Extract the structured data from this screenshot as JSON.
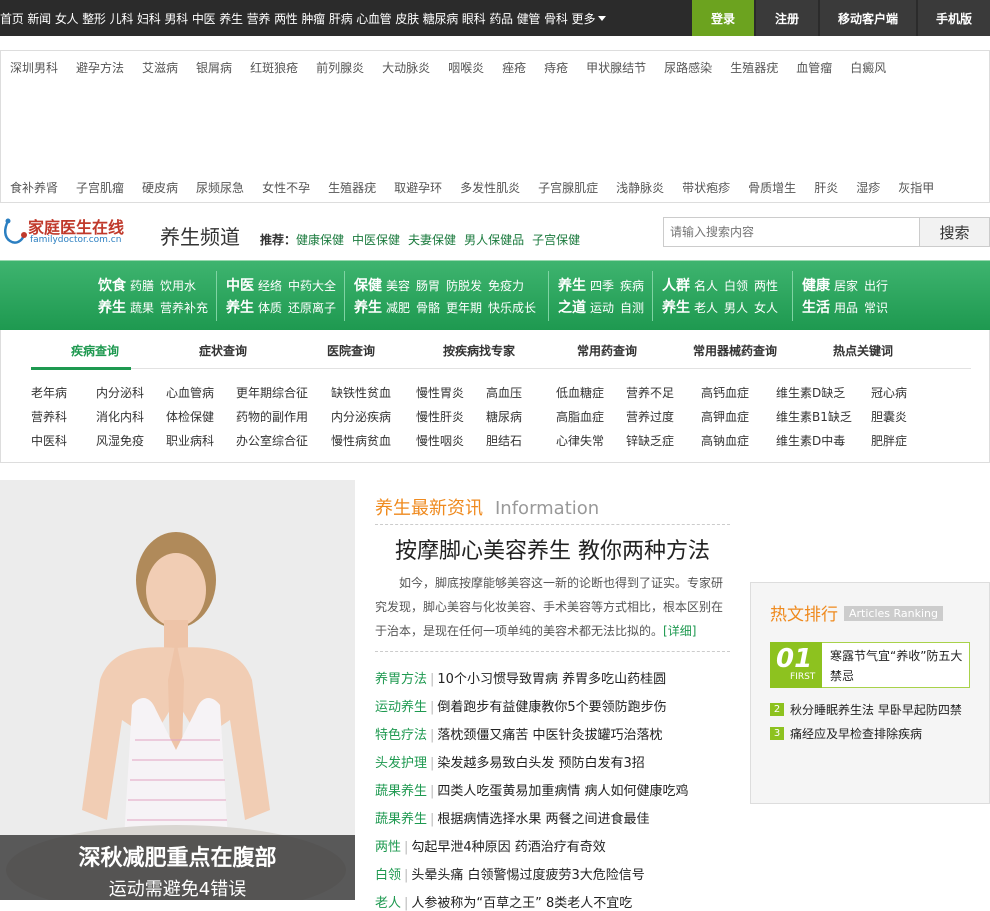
{
  "topnav": {
    "items": [
      "首页",
      "新闻",
      "女人",
      "整形",
      "儿科",
      "妇科",
      "男科",
      "中医",
      "养生",
      "营养",
      "两性",
      "肿瘤",
      "肝病",
      "心血管",
      "皮肤",
      "糖尿病",
      "眼科",
      "药品",
      "健管",
      "骨科"
    ],
    "more": "更多",
    "login": "登录",
    "register": "注册",
    "mobile_client": "移动客户端",
    "mobile_version": "手机版"
  },
  "diseases": {
    "row1": [
      "深圳男科",
      "避孕方法",
      "艾滋病",
      "银屑病",
      "红斑狼疮",
      "前列腺炎",
      "大动脉炎",
      "咽喉炎",
      "痤疮",
      "痔疮",
      "甲状腺结节",
      "尿路感染",
      "生殖器疣",
      "血管瘤",
      "白癜风"
    ],
    "row2": [
      "食补养肾",
      "子宫肌瘤",
      "硬皮病",
      "尿频尿急",
      "女性不孕",
      "生殖器疣",
      "取避孕环",
      "多发性肌炎",
      "子宫腺肌症",
      "浅静脉炎",
      "带状疱疹",
      "骨质增生",
      "肝炎",
      "湿疹",
      "灰指甲"
    ]
  },
  "header": {
    "logo_cn": "家庭医生在线",
    "logo_en": "familydoctor.com.cn",
    "channel": "养生频道",
    "recommend_label": "推荐：",
    "recommend_links": [
      "健康保健",
      "中医保健",
      "夫妻保健",
      "男人保健品",
      "子宫保健"
    ],
    "search_placeholder": "请输入搜索内容",
    "search_button": "搜索"
  },
  "green_nav": [
    {
      "h1": "饮食",
      "l1": [
        "药膳",
        "饮用水"
      ],
      "h2": "养生",
      "l2": [
        "蔬果",
        "营养补充"
      ]
    },
    {
      "h1": "中医",
      "l1": [
        "经络",
        "中药大全"
      ],
      "h2": "养生",
      "l2": [
        "体质",
        "还原离子"
      ]
    },
    {
      "h1": "保健",
      "l1": [
        "美容",
        "肠胃",
        "防脱发",
        "免疫力"
      ],
      "h2": "养生",
      "l2": [
        "减肥",
        "骨骼",
        "更年期",
        "快乐成长"
      ]
    },
    {
      "h1": "养生",
      "l1": [
        "四季",
        "疾病"
      ],
      "h2": "之道",
      "l2": [
        "运动",
        "自测"
      ]
    },
    {
      "h1": "人群",
      "l1": [
        "名人",
        "白领",
        "两性"
      ],
      "h2": "养生",
      "l2": [
        "老人",
        "男人",
        "女人"
      ]
    },
    {
      "h1": "健康",
      "l1": [
        "居家",
        "出行"
      ],
      "h2": "生活",
      "l2": [
        "用品",
        "常识"
      ]
    }
  ],
  "tabs": [
    "疾病查询",
    "症状查询",
    "医院查询",
    "按疾病找专家",
    "常用药查询",
    "常用器械药查询",
    "热点关键词"
  ],
  "keywords": [
    [
      "老年病",
      "内分泌科",
      "心血管病",
      "更年期综合征",
      "缺铁性贫血",
      "慢性胃炎",
      "高血压",
      "低血糖症",
      "营养不足",
      "高钙血症",
      "维生素D缺乏",
      "冠心病"
    ],
    [
      "营养科",
      "消化内科",
      "体检保健",
      "药物的副作用",
      "内分泌疾病",
      "慢性肝炎",
      "糖尿病",
      "高脂血症",
      "营养过度",
      "高钾血症",
      "维生素B1缺乏",
      "胆囊炎"
    ],
    [
      "中医科",
      "风湿免疫",
      "职业病科",
      "办公室综合征",
      "慢性病贫血",
      "慢性咽炎",
      "胆结石",
      "心律失常",
      "锌缺乏症",
      "高钠血症",
      "维生素D中毒",
      "肥胖症"
    ]
  ],
  "hero": {
    "title": "深秋减肥重点在腹部",
    "subtitle": "运动需避免4错误"
  },
  "news": {
    "heading_cn": "养生最新资讯",
    "heading_en": "Information",
    "lead_title": "按摩脚心美容养生 教你两种方法",
    "lead_text": "如今，脚底按摩能够美容这一新的论断也得到了证实。专家研究发现，脚心美容与化妆美容、手术美容等方式相比，根本区别在于治本，是现在任何一项单纯的美容术都无法比拟的。",
    "lead_more": "[详细]",
    "items": [
      {
        "cat": "养胃方法",
        "title": "10个小习惯导致胃病 养胃多吃山药桂圆"
      },
      {
        "cat": "运动养生",
        "title": "倒着跑步有益健康教你5个要领防跑步伤"
      },
      {
        "cat": "特色疗法",
        "title": "落枕颈僵又痛苦 中医针灸拔罐巧治落枕"
      },
      {
        "cat": "头发护理",
        "title": "染发越多易致白头发 预防白发有3招"
      },
      {
        "cat": "蔬果养生",
        "title": "四类人吃蛋黄易加重病情 病人如何健康吃鸡"
      },
      {
        "cat": "蔬果养生",
        "title": "根据病情选择水果 两餐之间进食最佳"
      },
      {
        "cat": "两性",
        "title": "勾起早泄4种原因 药酒治疗有奇效"
      },
      {
        "cat": "白领",
        "title": "头晕头痛 白领警惕过度疲劳3大危险信号"
      },
      {
        "cat": "老人",
        "title": "人参被称为“百草之王” 8类老人不宜吃"
      }
    ]
  },
  "hot": {
    "heading_cn": "热文排行",
    "heading_en": "Articles Ranking",
    "first_num": "01",
    "first_label": "FIRST",
    "first_title": "寒露节气宜“养收”防五大禁忌",
    "items": [
      {
        "num": "2",
        "title": "秋分睡眠养生法 早卧早起防四禁"
      },
      {
        "num": "3",
        "title": "痛经应及早检查排除疾病"
      }
    ]
  },
  "colors": {
    "green": "#1e9950",
    "orange": "#ef8a1e",
    "login_bg": "#6ca31f"
  }
}
